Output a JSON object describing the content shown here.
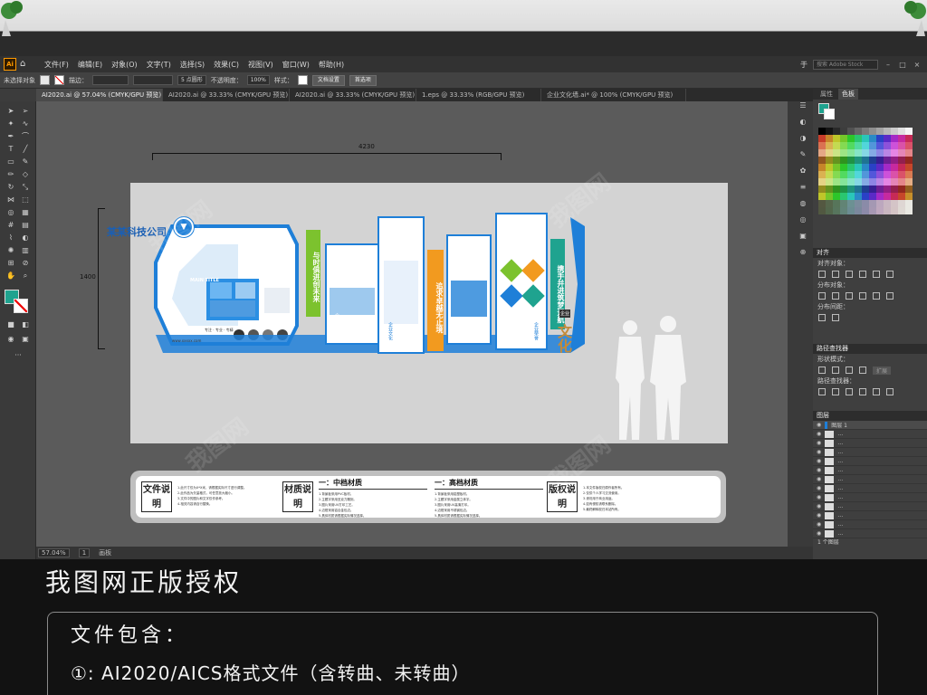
{
  "menu": {
    "items": [
      "文件(F)",
      "编辑(E)",
      "对象(O)",
      "文字(T)",
      "选择(S)",
      "效果(C)",
      "视图(V)",
      "窗口(W)",
      "帮助(H)"
    ],
    "search_placeholder": "搜索 Adobe Stock",
    "right_label": "于"
  },
  "control_bar": {
    "selection_label": "未选择对象",
    "stroke_label": "描边：",
    "brush_value": "5 点圆形",
    "opacity_label": "不透明度：",
    "opacity_value": "100%",
    "style_label": "样式：",
    "doc_setup": "文档设置",
    "prefs": "首选项"
  },
  "tabs": [
    {
      "label": "AI2020.ai @ 57.04% (CMYK/GPU 预览)",
      "active": true
    },
    {
      "label": "AI2020.ai @ 33.33% (CMYK/GPU 预览)",
      "active": false
    },
    {
      "label": "AI2020.ai @ 33.33% (CMYK/GPU 预览)",
      "active": false
    },
    {
      "label": "1.eps @ 33.33% (RGB/GPU 预览)",
      "active": false
    },
    {
      "label": "企业文化墙.ai* @ 100% (CMYK/GPU 预览)",
      "active": false
    }
  ],
  "status": {
    "zoom": "57.04%",
    "page": "1",
    "mode": "画板"
  },
  "panels": {
    "swatch_tabs": [
      "属性",
      "色板"
    ],
    "align": {
      "title": "对齐",
      "align_objects": "对齐对象：",
      "distribute_objects": "分布对象：",
      "distribute_spacing": "分布间距：",
      "align_to": "对齐："
    },
    "pathfinder": {
      "title": "路径查找器",
      "shape_modes": "形状模式：",
      "pathfinders": "路径查找器：",
      "expand": "扩展"
    },
    "layers": {
      "title": "图层",
      "layer_name": "图层 1",
      "count": "1 个图层"
    }
  },
  "artboard": {
    "width_dim": "4230",
    "height_dim": "1400",
    "company": "某某科技公司",
    "slogan_1": "与时俱进创未来",
    "slogan_2": "追求卓越无止境",
    "slogan_3": "携手并进筑梦远航",
    "culture": "文化",
    "culture_tag": "企业",
    "panel_labels": [
      "企业简介",
      "企业文化",
      "发展历程",
      "企业荣誉"
    ],
    "main_title": "MAIN TITLE",
    "contact": "www.xxxxx.com",
    "tagline": "专注 · 专业 · 专精"
  },
  "spec": {
    "file_label": "文件说明",
    "material_label": "材质说明",
    "mid_heading": "一：中档材质",
    "high_heading": "一：高档材质",
    "copyright_label": "版权说明",
    "file_lines": [
      "1.此尺寸仅为X*X米，请根据实际尺寸进行调整。",
      "2.此作品为矢量格式，可任意放大缩小。",
      "3.文件中的图片和文字仅作参考。",
      "4.相关内容请自行替换。"
    ],
    "mid_lines": [
      "1.背景板采用PVC板材。",
      "2.主题字采用亚克力雕刻。",
      "3.图片采用UV打印工艺。",
      "4.边框采用铝合金包边。",
      "5.具体材质请根据实际情况选择。"
    ],
    "high_lines": [
      "1.背景板采用铝塑板材。",
      "2.主题字采用金属立体字。",
      "3.图片采用UV高清打印。",
      "4.边框采用不锈钢包边。",
      "5.具体材质请根据实际情况选择。"
    ],
    "copyright_lines": [
      "1.本文件版权归原作者所有。",
      "2.仅供个人学习交流使用。",
      "3.请勿用于商业用途。",
      "4.如有侵权请联系删除。",
      "5.最终解释权归本站所有。"
    ]
  },
  "footer": {
    "auth_title": "我图网正版授权",
    "contains_title": "文件包含：",
    "contains_item": "①: AI2020/AICS格式文件（含转曲、未转曲）"
  },
  "watermark": "我图网",
  "colors": {
    "brand_blue": "#1e7fd8",
    "green": "#7cc22e",
    "orange": "#f29a1f",
    "teal": "#1fa38f",
    "ai_orange": "#ff9a00"
  }
}
